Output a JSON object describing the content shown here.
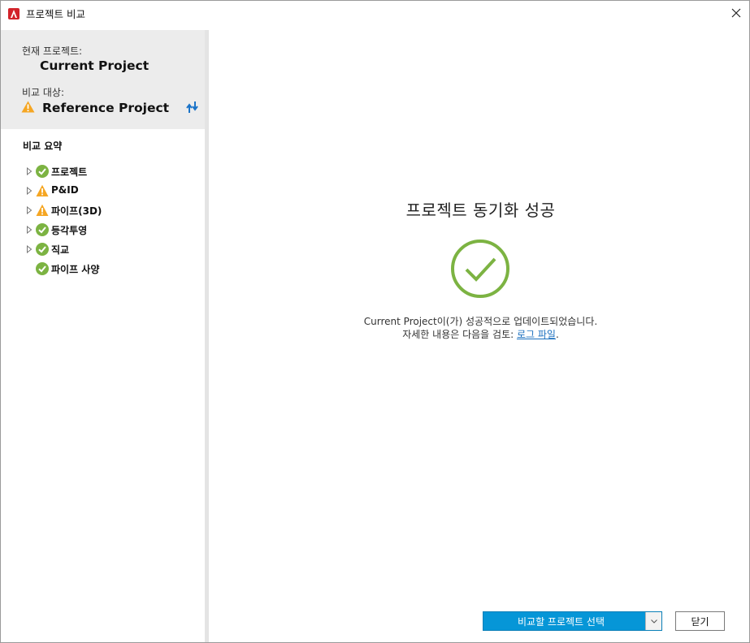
{
  "window": {
    "title": "프로젝트 비교",
    "accent_color": "#0696d7"
  },
  "sidebar": {
    "current_label": "현재 프로젝트:",
    "current_name": "Current Project",
    "reference_label": "비교 대상:",
    "reference_name": "Reference Project",
    "summary_title": "비교 요약",
    "tree": [
      {
        "label": "프로젝트",
        "status": "success",
        "expandable": true
      },
      {
        "label": "P&ID",
        "status": "warning",
        "expandable": true
      },
      {
        "label": "파이프(3D)",
        "status": "warning",
        "expandable": true
      },
      {
        "label": "등각투영",
        "status": "success",
        "expandable": true
      },
      {
        "label": "직교",
        "status": "success",
        "expandable": true
      },
      {
        "label": "파이프 사양",
        "status": "success",
        "expandable": false
      }
    ]
  },
  "main": {
    "title": "프로젝트 동기화 성공",
    "message_line1": "Current Project이(가) 성공적으로 업데이트되었습니다.",
    "message_line2_prefix": "자세한 내용은 다음을 검토: ",
    "log_link": "로그 파일",
    "message_line2_suffix": "."
  },
  "footer": {
    "select_label": "비교할 프로젝트 선택",
    "close_label": "닫기"
  },
  "colors": {
    "success": "#7cb342",
    "warning": "#f5a623",
    "link": "#1a6fbf"
  }
}
